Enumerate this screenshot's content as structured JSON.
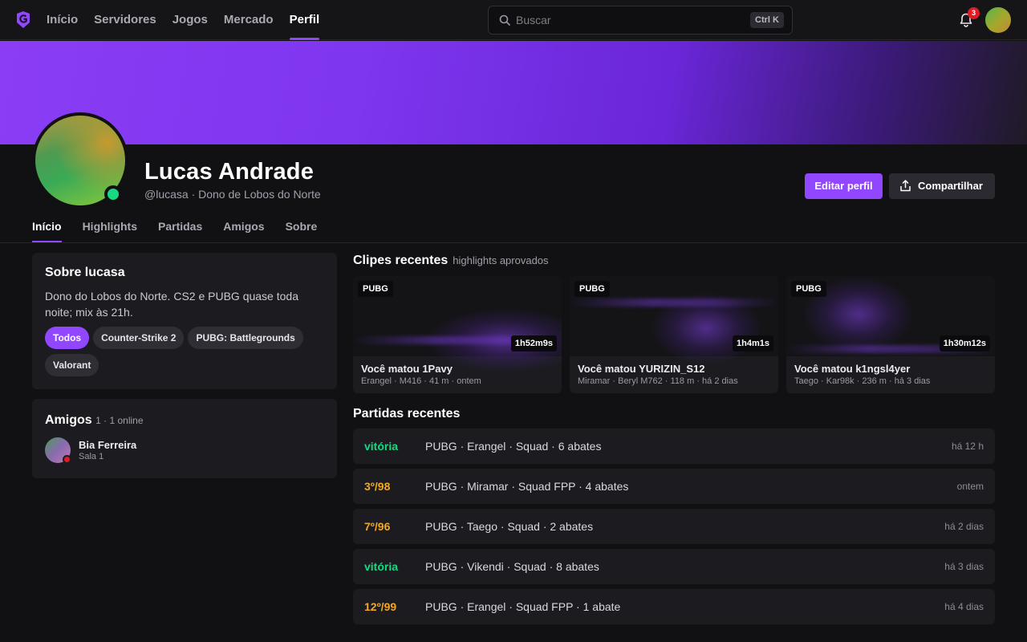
{
  "nav": {
    "items": [
      "Início",
      "Servidores",
      "Jogos",
      "Mercado",
      "Perfil"
    ],
    "active_index": 4
  },
  "search": {
    "placeholder": "Buscar",
    "shortcut": "Ctrl K"
  },
  "notifications": {
    "count": "3"
  },
  "profile": {
    "name": "Lucas Andrade",
    "subtitle": "@lucasa · Dono de Lobos do Norte",
    "status": "online",
    "edit_label": "Editar perfil",
    "share_label": "Compartilhar"
  },
  "tabs": {
    "items": [
      "Início",
      "Highlights",
      "Partidas",
      "Amigos",
      "Sobre"
    ],
    "active_index": 0
  },
  "about": {
    "title": "Sobre lucasa",
    "text": "Dono do Lobos do Norte. CS2 e PUBG quase toda noite; mix às 21h.",
    "chips": [
      "Todos",
      "Counter-Strike 2",
      "PUBG: Battlegrounds",
      "Valorant"
    ],
    "active_chip": 0
  },
  "friends": {
    "title": "Amigos",
    "count": "1 · 1 online",
    "items": [
      {
        "name": "Bia Ferreira",
        "room": "Sala 1"
      }
    ]
  },
  "clips": {
    "title": "Clipes recentes",
    "subtitle": "highlights aprovados",
    "items": [
      {
        "tag": "PUBG",
        "duration": "1h52m9s",
        "title": "Você matou 1Pavy",
        "meta": "Erangel · M416 · 41 m · ontem"
      },
      {
        "tag": "PUBG",
        "duration": "1h4m1s",
        "title": "Você matou YURIZIN_S12",
        "meta": "Miramar · Beryl M762 · 118 m · há 2 dias"
      },
      {
        "tag": "PUBG",
        "duration": "1h30m12s",
        "title": "Você matou k1ngsl4yer",
        "meta": "Taego · Kar98k · 236 m · há 3 dias"
      }
    ]
  },
  "matches": {
    "title": "Partidas recentes",
    "items": [
      {
        "result": "vitória",
        "kind": "win",
        "desc": "PUBG · Erangel · Squad · 6 abates",
        "time": "há 12 h"
      },
      {
        "result": "3º/98",
        "kind": "place",
        "desc": "PUBG · Miramar · Squad FPP · 4 abates",
        "time": "ontem"
      },
      {
        "result": "7º/96",
        "kind": "place",
        "desc": "PUBG · Taego · Squad · 2 abates",
        "time": "há 2 dias"
      },
      {
        "result": "vitória",
        "kind": "win",
        "desc": "PUBG · Vikendi · Squad · 8 abates",
        "time": "há 3 dias"
      },
      {
        "result": "12º/99",
        "kind": "place",
        "desc": "PUBG · Erangel · Squad FPP · 1 abate",
        "time": "há 4 dias"
      }
    ]
  },
  "colors": {
    "accent": "#9147ff",
    "online": "#17d982",
    "win": "#17d982",
    "place": "#f0a828",
    "badge": "#e01b24"
  }
}
